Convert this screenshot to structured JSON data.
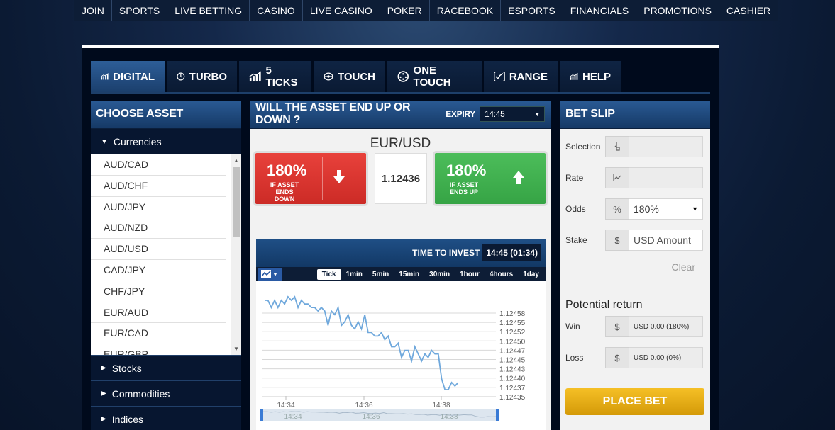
{
  "nav": [
    "JOIN",
    "SPORTS",
    "LIVE BETTING",
    "CASINO",
    "LIVE CASINO",
    "POKER",
    "RACEBOOK",
    "ESPORTS",
    "FINANCIALS",
    "PROMOTIONS",
    "CASHIER"
  ],
  "tabs": [
    {
      "label": "DIGITAL",
      "icon": "bar-chart-icon",
      "active": true
    },
    {
      "label": "TURBO",
      "icon": "clock-icon"
    },
    {
      "label": "5 TICKS",
      "icon": "bar-chart-icon"
    },
    {
      "label": "TOUCH",
      "icon": "target-icon"
    },
    {
      "label": "ONE TOUCH",
      "icon": "dial-icon"
    },
    {
      "label": "RANGE",
      "icon": "range-chart-icon"
    },
    {
      "label": "HELP",
      "icon": "bar-chart-icon"
    }
  ],
  "asset_panel": {
    "title": "CHOOSE ASSET",
    "categories": {
      "currencies": "Currencies",
      "stocks": "Stocks",
      "commodities": "Commodities",
      "indices": "Indices"
    },
    "assets": [
      "AUD/CAD",
      "AUD/CHF",
      "AUD/JPY",
      "AUD/NZD",
      "AUD/USD",
      "CAD/JPY",
      "CHF/JPY",
      "EUR/AUD",
      "EUR/CAD",
      "EUR/GBP"
    ]
  },
  "trade": {
    "question": "WILL THE ASSET END UP OR DOWN ?",
    "expiry_label": "EXPIRY",
    "expiry_value": "14:45",
    "pair": "EUR/USD",
    "price": "1.12436",
    "down": {
      "pct": "180%",
      "line1": "IF ASSET",
      "line2": "ENDS DOWN"
    },
    "up": {
      "pct": "180%",
      "line1": "IF ASSET",
      "line2": "ENDS UP"
    },
    "time_to_invest_label": "TIME TO INVEST",
    "time_to_invest_value": "14:45 (01:34)",
    "ranges": [
      "Tick",
      "1min",
      "5min",
      "15min",
      "30min",
      "1hour",
      "4hours",
      "1day"
    ],
    "active_range": "Tick"
  },
  "chart_data": {
    "type": "line",
    "y_ticks": [
      "1.12458",
      "1.12455",
      "1.12452",
      "1.12450",
      "1.12447",
      "1.12445",
      "1.12443",
      "1.12440",
      "1.12437",
      "1.12435"
    ],
    "x_ticks": [
      "14:34",
      "14:36",
      "14:38"
    ],
    "navigator_ticks": [
      "14:34",
      "14:36",
      "14:38"
    ],
    "ylim": [
      1.12433,
      1.1246
    ],
    "line_color": "#6fa8dc",
    "values": [
      1.12459,
      1.12459,
      1.12457,
      1.12459,
      1.12457,
      1.12459,
      1.12458,
      1.1246,
      1.12459,
      1.1246,
      1.12457,
      1.12459,
      1.12458,
      1.12458,
      1.12457,
      1.12457,
      1.12456,
      1.12457,
      1.12456,
      1.12452,
      1.12456,
      1.12455,
      1.12457,
      1.12452,
      1.12453,
      1.12455,
      1.12452,
      1.12451,
      1.12453,
      1.12451,
      1.12455,
      1.1245,
      1.1245,
      1.12449,
      1.12449,
      1.1245,
      1.12448,
      1.12449,
      1.12446,
      1.12446,
      1.12447,
      1.12443,
      1.12445,
      1.12445,
      1.12442,
      1.12446,
      1.12444,
      1.12442,
      1.12444,
      1.12443,
      1.12445,
      1.12444,
      1.12444,
      1.12437,
      1.12434,
      1.12434,
      1.12436,
      1.12435,
      1.12436
    ]
  },
  "bet_slip": {
    "title": "BET SLIP",
    "selection_label": "Selection",
    "rate_label": "Rate",
    "odds_label": "Odds",
    "odds_unit": "%",
    "odds_value": "180%",
    "stake_label": "Stake",
    "stake_unit": "$",
    "stake_placeholder": "USD Amount",
    "clear": "Clear",
    "potential_title": "Potential return",
    "win_label": "Win",
    "win_unit": "$",
    "win_value": "USD 0.00 (180%)",
    "loss_label": "Loss",
    "loss_unit": "$",
    "loss_value": "USD 0.00 (0%)",
    "place_bet": "PLACE BET"
  }
}
